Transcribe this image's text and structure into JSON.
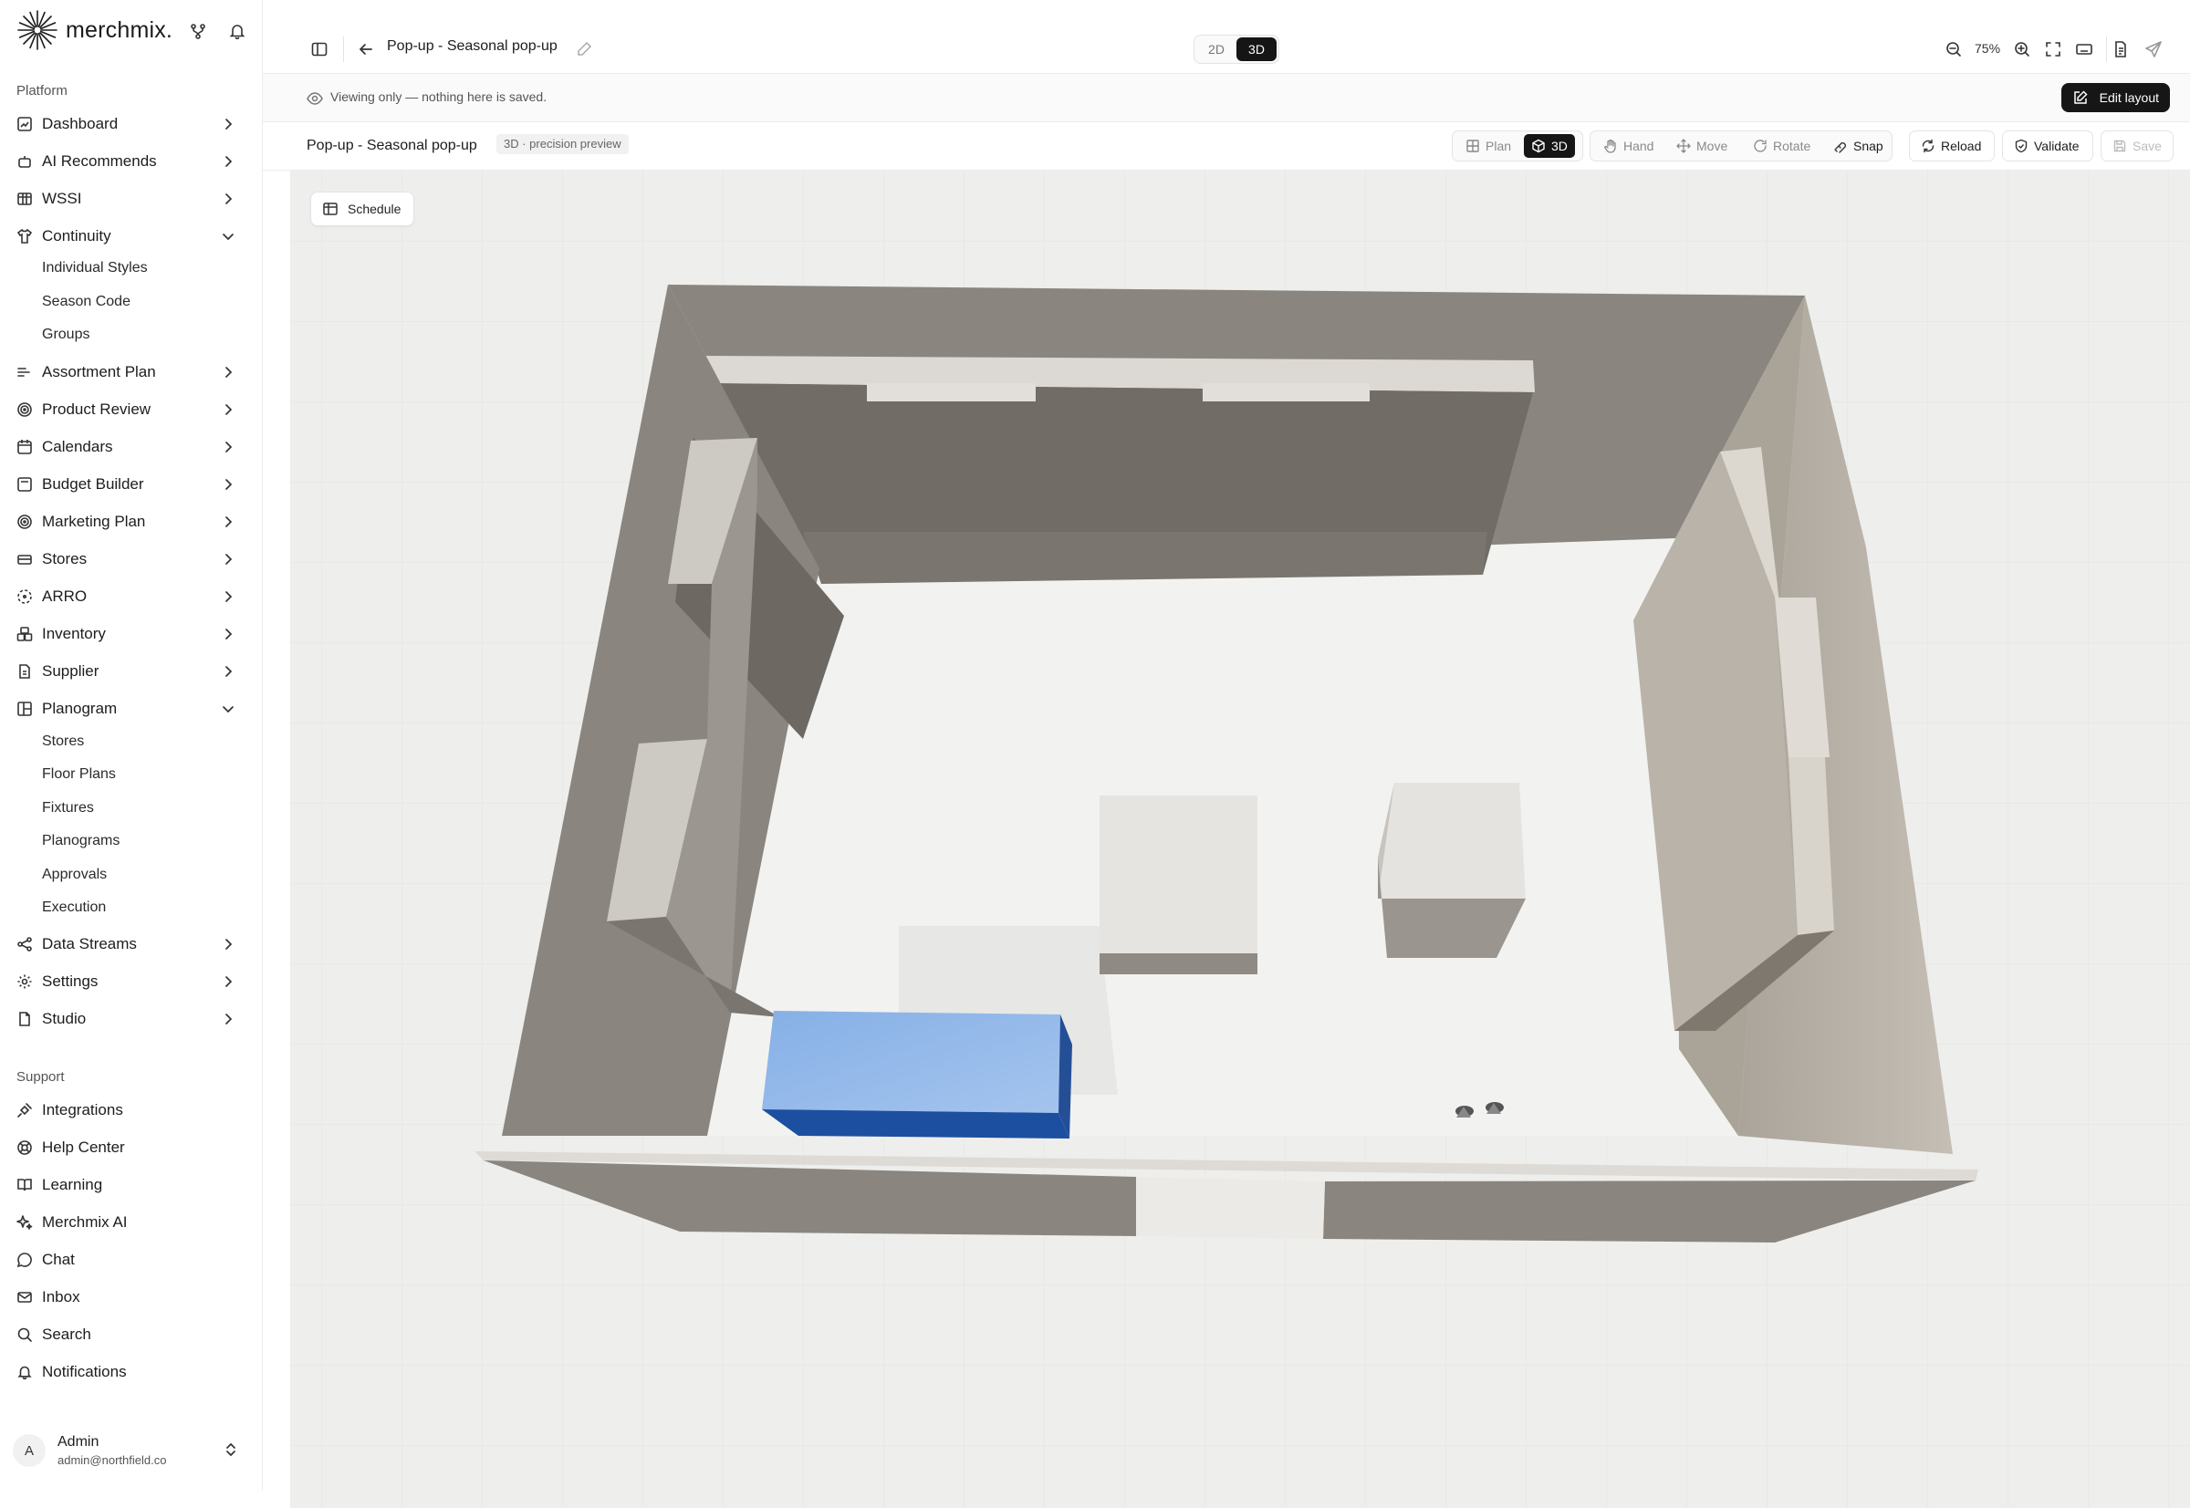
{
  "brand": {
    "name": "merchmix."
  },
  "sidebar": {
    "platform_label": "Platform",
    "support_label": "Support",
    "items": [
      {
        "label": "Dashboard",
        "icon": "dashboard-icon"
      },
      {
        "label": "AI Recommends",
        "icon": "robot-icon"
      },
      {
        "label": "WSSI",
        "icon": "table-icon"
      },
      {
        "label": "Continuity",
        "icon": "shirt-icon"
      },
      {
        "label": "Assortment Plan",
        "icon": "sliders-icon"
      },
      {
        "label": "Product Review",
        "icon": "target-icon"
      },
      {
        "label": "Calendars",
        "icon": "calendar-icon"
      },
      {
        "label": "Budget Builder",
        "icon": "calculator-icon"
      },
      {
        "label": "Marketing Plan",
        "icon": "target-icon"
      },
      {
        "label": "Stores",
        "icon": "store-icon"
      },
      {
        "label": "ARRO",
        "icon": "dashed-circle-icon"
      },
      {
        "label": "Inventory",
        "icon": "boxes-icon"
      },
      {
        "label": "Supplier",
        "icon": "document-icon"
      },
      {
        "label": "Planogram",
        "icon": "grid-icon"
      },
      {
        "label": "Data Streams",
        "icon": "share-icon"
      },
      {
        "label": "Settings",
        "icon": "gear-icon"
      },
      {
        "label": "Studio",
        "icon": "file-icon"
      }
    ],
    "continuity_sub": [
      "Individual Styles",
      "Season Code",
      "Groups"
    ],
    "planogram_sub": [
      "Stores",
      "Floor Plans",
      "Fixtures",
      "Planograms",
      "Approvals",
      "Execution"
    ],
    "support_items": [
      {
        "label": "Integrations",
        "icon": "plug-icon"
      },
      {
        "label": "Help Center",
        "icon": "lifebuoy-icon"
      },
      {
        "label": "Learning",
        "icon": "book-icon"
      },
      {
        "label": "Merchmix AI",
        "icon": "sparkle-icon"
      },
      {
        "label": "Chat",
        "icon": "chat-icon"
      },
      {
        "label": "Inbox",
        "icon": "mail-icon"
      },
      {
        "label": "Search",
        "icon": "search-icon"
      },
      {
        "label": "Notifications",
        "icon": "bell-icon"
      }
    ],
    "user": {
      "initial": "A",
      "name": "Admin",
      "email": "admin@northfield.co"
    }
  },
  "topbar": {
    "title": "Pop-up - Seasonal pop-up",
    "view_2d": "2D",
    "view_3d": "3D",
    "zoom": "75%"
  },
  "banner": {
    "text": "Viewing only — nothing here is saved.",
    "edit_label": "Edit layout"
  },
  "toolbar": {
    "title": "Pop-up - Seasonal pop-up",
    "badge": "3D · precision preview",
    "plan": "Plan",
    "three_d": "3D",
    "hand": "Hand",
    "move": "Move",
    "rotate": "Rotate",
    "snap": "Snap",
    "reload": "Reload",
    "validate": "Validate",
    "save": "Save"
  },
  "canvas": {
    "schedule_label": "Schedule",
    "colors": {
      "floor": "#eeeeec",
      "wall_dark": "#6f6b65",
      "wall_mid": "#8a857e",
      "wall_light": "#b5afa6",
      "fixture_top": "#e6e4e0",
      "highlight_top": "#93b8e8",
      "highlight_side": "#1c4fa0"
    }
  }
}
